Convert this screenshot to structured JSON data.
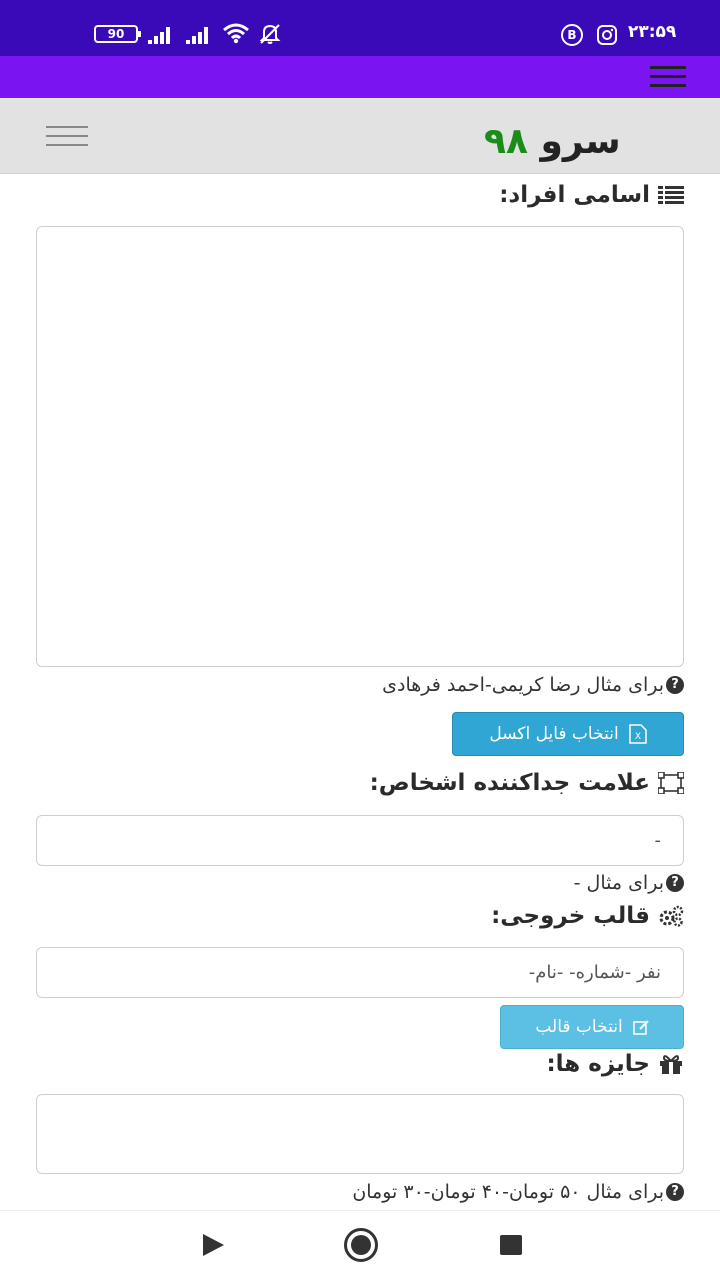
{
  "status_bar": {
    "battery": "90",
    "time": "۲۳:۵۹",
    "badge_letter": "B",
    "icons": [
      "battery-icon",
      "signal-icon",
      "signal-icon",
      "wifi-icon",
      "bell-off-icon",
      "b-badge-icon",
      "instagram-icon"
    ]
  },
  "header": {
    "logo_part1": "سرو",
    "logo_part2": "۹۸",
    "logo_color_dark": "#222222",
    "logo_color_green": "#1a8c1a"
  },
  "colors": {
    "status_bar": "#3a0ab8",
    "app_bar": "#7a14f0",
    "header_bg": "#e2e2e2",
    "button_primary": "#2fa6d4",
    "button_secondary": "#5bc0e3"
  },
  "form": {
    "names": {
      "label": "اسامی افراد:",
      "value": "",
      "help": "برای مثال رضا کریمی-احمد فرهادی",
      "excel_button": "انتخاب فایل اکسل"
    },
    "separator": {
      "label": "علامت جداکننده اشخاص:",
      "value": "-",
      "help": "برای مثال -"
    },
    "template": {
      "label": "قالب خروجی:",
      "value": "نفر -شماره- -نام-",
      "button": "انتخاب قالب"
    },
    "prizes": {
      "label": "جایزه ها:",
      "value": "",
      "help": "برای مثال ۵۰ تومان-۴۰ تومان-۳۰ تومان"
    }
  },
  "nav_bar": {
    "icons": [
      "back-icon",
      "home-icon",
      "recents-icon"
    ]
  }
}
